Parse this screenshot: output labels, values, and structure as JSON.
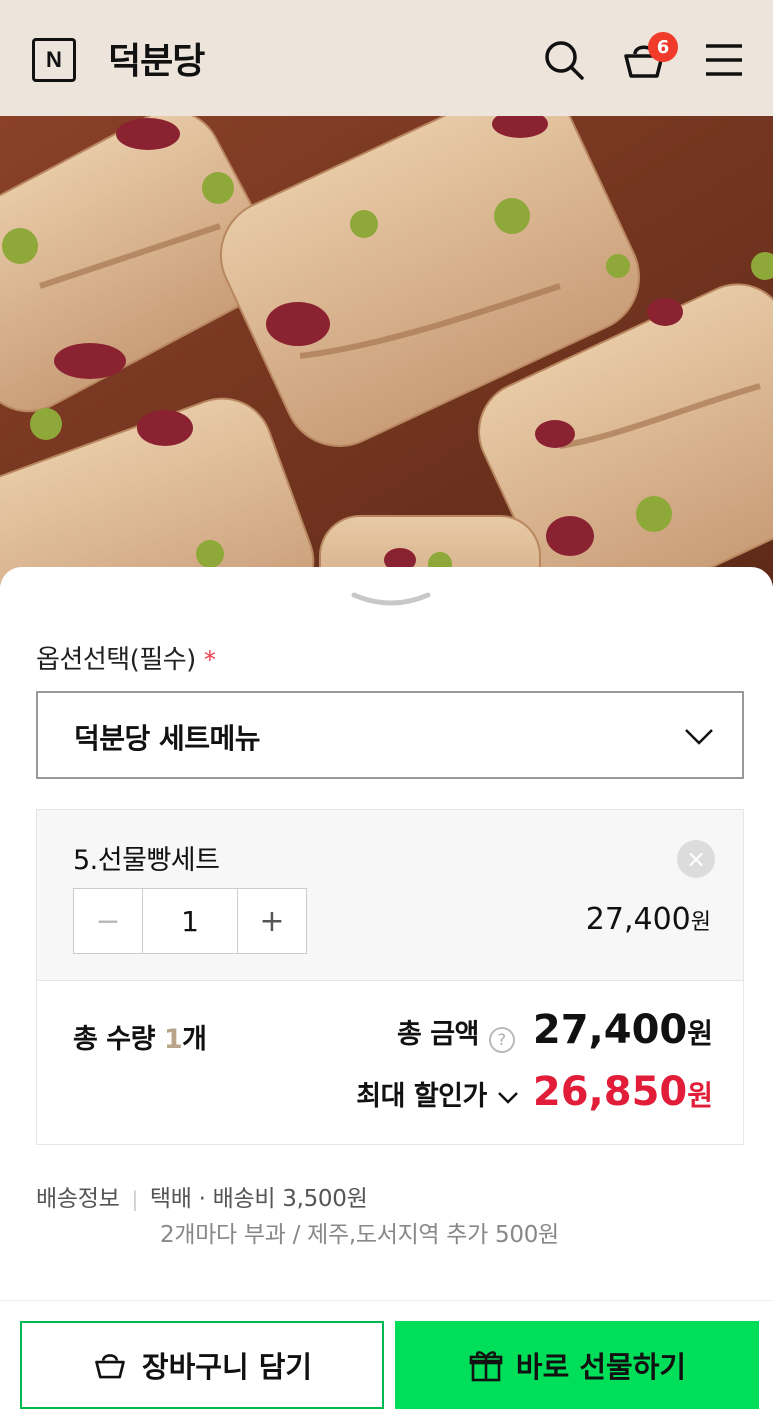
{
  "header": {
    "logo_letter": "N",
    "store_name": "덕분당",
    "cart_count": "6"
  },
  "product_image": {
    "alt": ""
  },
  "options": {
    "label": "옵션선택(필수)",
    "required_mark": "*",
    "selected": "덕분당 세트메뉴"
  },
  "item": {
    "name": "5.선물빵세트",
    "minus": "−",
    "quantity": "1",
    "plus": "+",
    "price": "27,400",
    "price_unit": "원",
    "remove": "×"
  },
  "totals": {
    "qty_label": "총 수량 ",
    "qty_value": "1",
    "qty_unit": "개",
    "amount_label": "총 금액",
    "help": "?",
    "amount_value": "27,400",
    "amount_unit": "원",
    "discount_label": "최대 할인가",
    "discount_value": "26,850",
    "discount_unit": "원"
  },
  "shipping": {
    "label": "배송정보",
    "separator": "|",
    "info": "택배 · 배송비 3,500원",
    "note": "2개마다 부과 / 제주,도서지역 추가 500원"
  },
  "actions": {
    "add_to_cart": "장바구니 담기",
    "gift_now": "바로 선물하기"
  },
  "colors": {
    "header_bg": "#ede4db",
    "accent_green": "#00de5a",
    "discount_red": "#e11d39",
    "badge_red": "#f03b2b"
  }
}
